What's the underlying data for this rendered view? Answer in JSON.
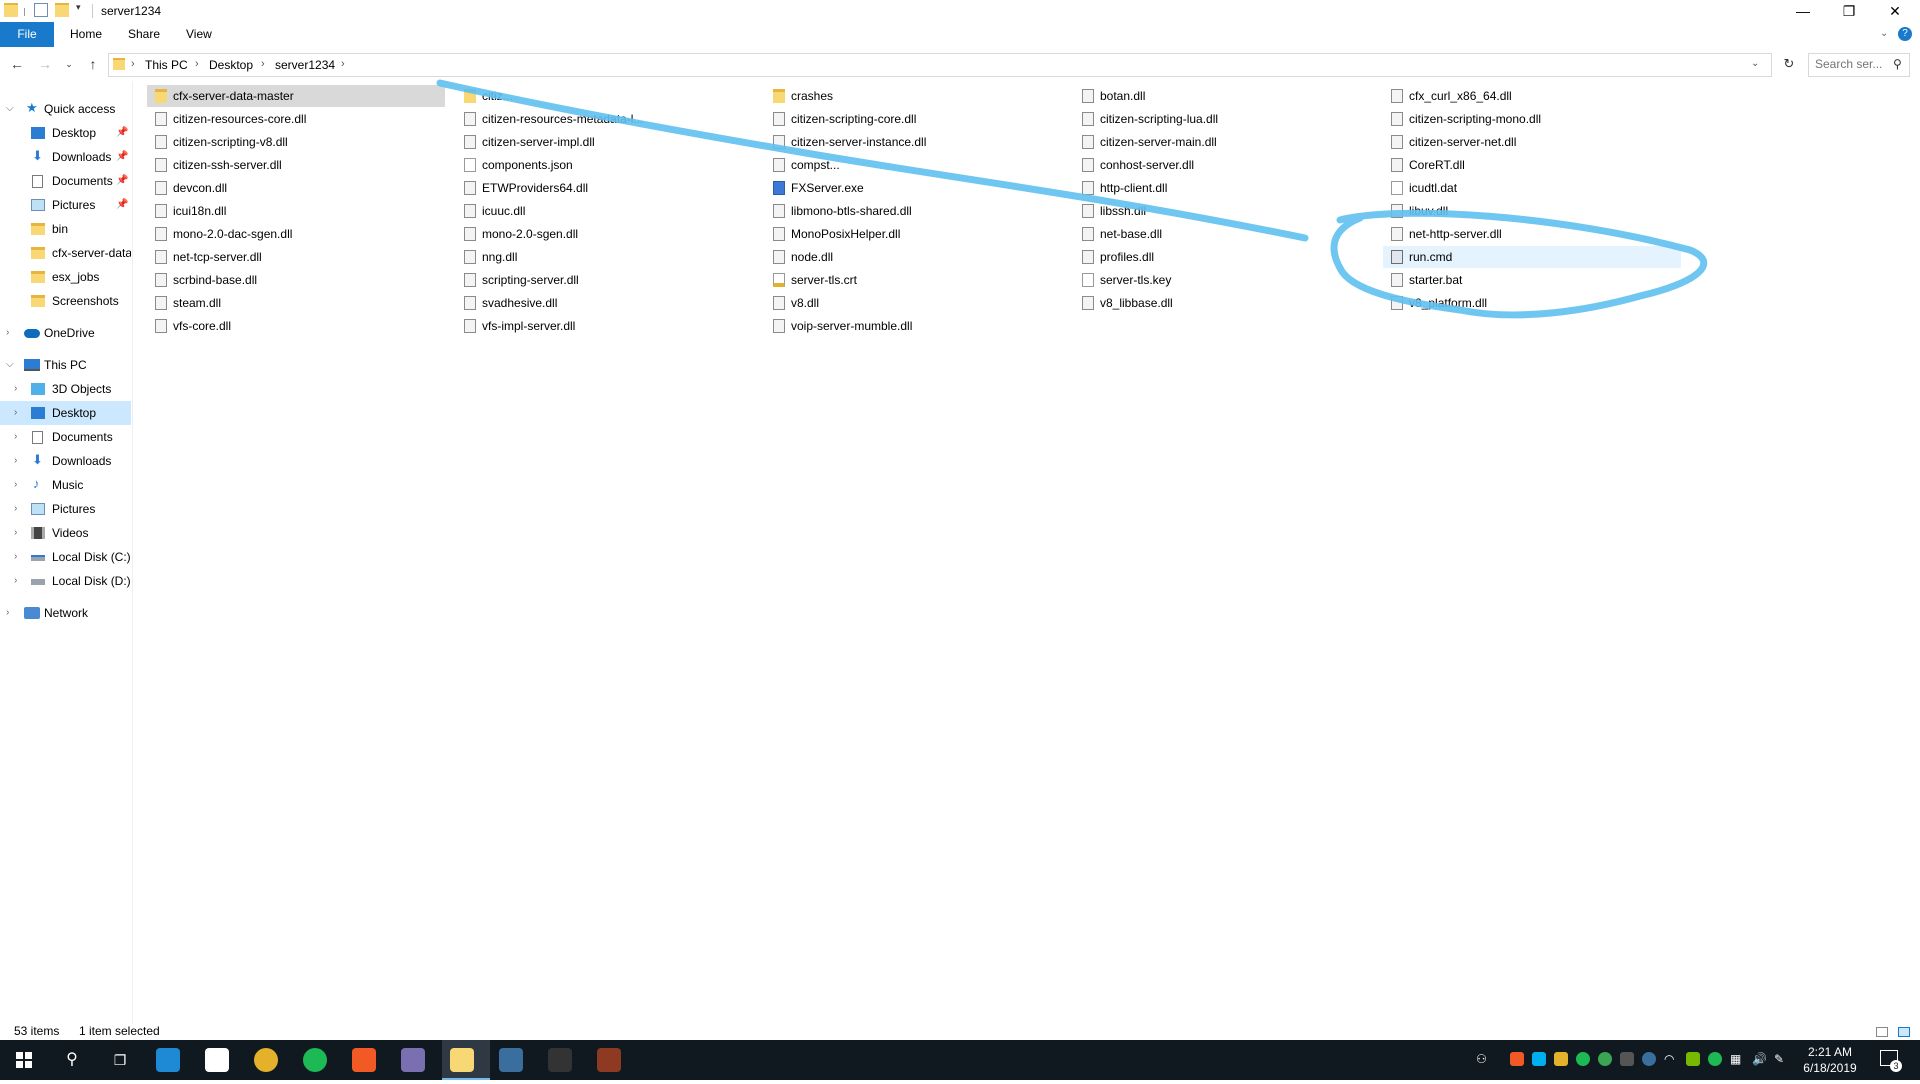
{
  "window": {
    "title": "server1234",
    "controls": {
      "minimize": "—",
      "maximize": "❐",
      "close": "✕"
    }
  },
  "ribbon": {
    "tabs": [
      "File",
      "Home",
      "Share",
      "View"
    ]
  },
  "address": {
    "crumbs": [
      "This PC",
      "Desktop",
      "server1234"
    ],
    "search_placeholder": "Search ser..."
  },
  "nav": {
    "quick_access": {
      "label": "Quick access",
      "items": [
        {
          "label": "Desktop",
          "icon": "desktop-icon",
          "pinned": true
        },
        {
          "label": "Downloads",
          "icon": "download-icon",
          "pinned": true
        },
        {
          "label": "Documents",
          "icon": "document-icon",
          "pinned": true
        },
        {
          "label": "Pictures",
          "icon": "pictures-icon",
          "pinned": true
        },
        {
          "label": "bin",
          "icon": "folder-icon",
          "pinned": false
        },
        {
          "label": "cfx-server-data",
          "icon": "folder-icon",
          "pinned": false
        },
        {
          "label": "esx_jobs",
          "icon": "folder-icon",
          "pinned": false
        },
        {
          "label": "Screenshots",
          "icon": "folder-icon",
          "pinned": false
        }
      ]
    },
    "onedrive": {
      "label": "OneDrive"
    },
    "this_pc": {
      "label": "This PC",
      "items": [
        {
          "label": "3D Objects",
          "icon": "3d-objects-icon"
        },
        {
          "label": "Desktop",
          "icon": "desktop-icon",
          "selected": true
        },
        {
          "label": "Documents",
          "icon": "document-icon"
        },
        {
          "label": "Downloads",
          "icon": "download-icon"
        },
        {
          "label": "Music",
          "icon": "music-icon"
        },
        {
          "label": "Pictures",
          "icon": "pictures-icon"
        },
        {
          "label": "Videos",
          "icon": "videos-icon"
        },
        {
          "label": "Local Disk (C:)",
          "icon": "drive-icon"
        },
        {
          "label": "Local Disk (D:)",
          "icon": "drive-icon"
        }
      ]
    },
    "network": {
      "label": "Network"
    }
  },
  "files": [
    [
      "cfx-server-data-master",
      "citizen-resources-core.dll",
      "citizen-scripting-v8.dll",
      "citizen-ssh-server.dll",
      "devcon.dll",
      "icui18n.dll",
      "mono-2.0-dac-sgen.dll",
      "net-tcp-server.dll",
      "scrbind-base.dll",
      "steam.dll",
      "vfs-core.dll"
    ],
    [
      "citiz...",
      "citizen-resources-metadata-l...",
      "citizen-server-impl.dll",
      "components.json",
      "ETWProviders64.dll",
      "icuuc.dll",
      "mono-2.0-sgen.dll",
      "nng.dll",
      "scripting-server.dll",
      "svadhesive.dll",
      "vfs-impl-server.dll"
    ],
    [
      "crashes",
      "citizen-scripting-core.dll",
      "citizen-server-instance.dll",
      "compst...",
      "FXServer.exe",
      "libmono-btls-shared.dll",
      "MonoPosixHelper.dll",
      "node.dll",
      "server-tls.crt",
      "v8.dll",
      "voip-server-mumble.dll"
    ],
    [
      "botan.dll",
      "citizen-scripting-lua.dll",
      "citizen-server-main.dll",
      "conhost-server.dll",
      "http-client.dll",
      "libssh.dll",
      "net-base.dll",
      "profiles.dll",
      "server-tls.key",
      "v8_libbase.dll"
    ],
    [
      "cfx_curl_x86_64.dll",
      "citizen-scripting-mono.dll",
      "citizen-server-net.dll",
      "CoreRT.dll",
      "icudtl.dat",
      "libuv.dll",
      "net-http-server.dll",
      "run.cmd",
      "starter.bat",
      "v8_platform.dll"
    ]
  ],
  "file_types": [
    [
      "folder",
      "dll",
      "dll",
      "dll",
      "dll",
      "dll",
      "dll",
      "dll",
      "dll",
      "dll",
      "dll"
    ],
    [
      "folder",
      "dll",
      "dll",
      "doc",
      "dll",
      "dll",
      "dll",
      "dll",
      "dll",
      "dll",
      "dll"
    ],
    [
      "folder",
      "dll",
      "dll",
      "dll",
      "exe",
      "dll",
      "dll",
      "dll",
      "crt",
      "dll",
      "dll"
    ],
    [
      "dll",
      "dll",
      "dll",
      "dll",
      "dll",
      "dll",
      "dll",
      "dll",
      "doc",
      "dll"
    ],
    [
      "dll",
      "dll",
      "dll",
      "dll",
      "doc",
      "dll",
      "dll",
      "cmd",
      "dll",
      "dll"
    ]
  ],
  "selected_file": "run.cmd",
  "status": {
    "count": "53 items",
    "selection": "1 item selected"
  },
  "taskbar": {
    "apps": [
      {
        "name": "edge-icon",
        "color": "#1e8ad6"
      },
      {
        "name": "store-icon",
        "color": "#ffffff"
      },
      {
        "name": "chrome-icon",
        "color": "#e4b12a"
      },
      {
        "name": "spotify-icon",
        "color": "#1db954"
      },
      {
        "name": "xampp-icon",
        "color": "#f15a24"
      },
      {
        "name": "app-badge-icon",
        "color": "#7a6fb0"
      },
      {
        "name": "file-explorer-icon",
        "color": "#f8d775"
      },
      {
        "name": "steam-icon",
        "color": "#3a6e9e"
      },
      {
        "name": "epic-games-icon",
        "color": "#333333"
      },
      {
        "name": "game-app-icon",
        "color": "#8e3a22"
      }
    ],
    "time": "2:21 AM",
    "date": "6/18/2019",
    "notification_count": "3"
  }
}
